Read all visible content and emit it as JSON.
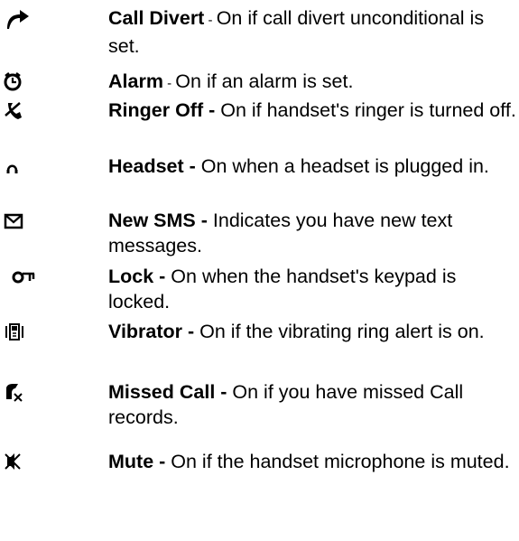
{
  "items": [
    {
      "icon": "call-divert-arrow-icon",
      "name": "Call Divert",
      "sep": " - ",
      "desc": "On if call divert unconditional is set."
    },
    {
      "icon": "alarm-clock-icon",
      "name": "Alarm",
      "sep": " - ",
      "desc": "On if an alarm is set."
    },
    {
      "icon": "ringer-off-icon",
      "name": "Ringer Off - ",
      "sep": "",
      "desc": "On if handset's ringer is turned off."
    },
    {
      "icon": "headset-icon",
      "name": "Headset - ",
      "sep": "",
      "desc": "On when a headset is plugged in."
    },
    {
      "icon": "envelope-icon",
      "name": "New SMS - ",
      "sep": "",
      "desc": "Indicates you have new text messages."
    },
    {
      "icon": "key-lock-icon",
      "name": "Lock - ",
      "sep": "",
      "desc": "On when the handset's keypad is locked."
    },
    {
      "icon": "vibrating-phone-icon",
      "name": "Vibrator - ",
      "sep": "",
      "desc": "On if the vibrating ring alert is on."
    },
    {
      "icon": "missed-call-icon",
      "name": "Missed Call - ",
      "sep": "",
      "desc": "On if you have missed Call records."
    },
    {
      "icon": "muted-microphone-icon",
      "name": "Mute - ",
      "sep": "",
      "desc": "On if the handset microphone is muted."
    }
  ]
}
